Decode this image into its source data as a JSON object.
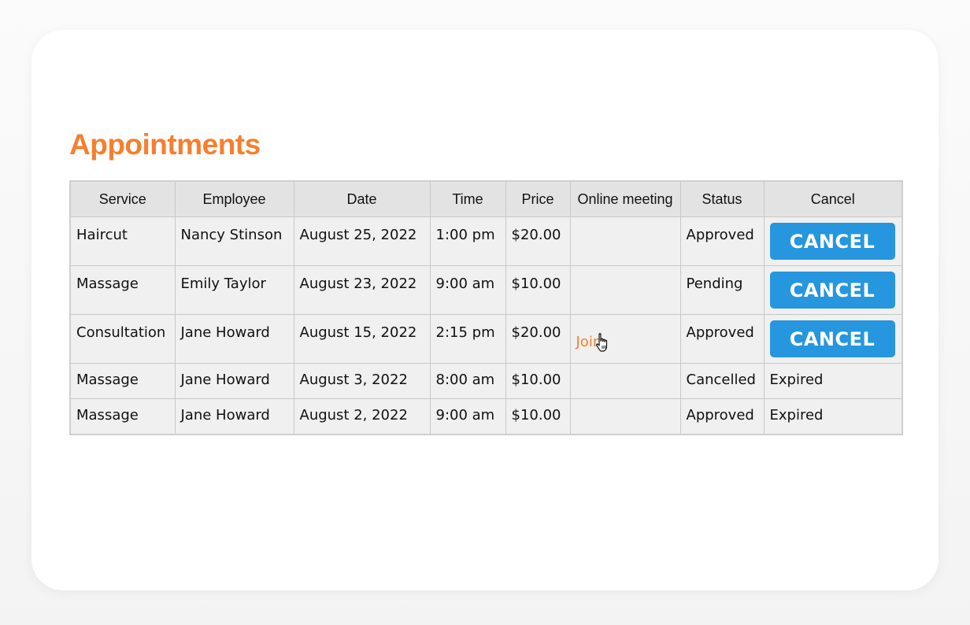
{
  "page": {
    "title": "Appointments"
  },
  "colors": {
    "title": "#f57f2f",
    "cancel_button": "#2696de",
    "join_link": "#f57f2f"
  },
  "table": {
    "headers": [
      "Service",
      "Employee",
      "Date",
      "Time",
      "Price",
      "Online meeting",
      "Status",
      "Cancel"
    ],
    "rows": [
      {
        "service": "Haircut",
        "employee": "Nancy Stinson",
        "date": "August 25, 2022",
        "time": "1:00 pm",
        "price": "$20.00",
        "meeting": "",
        "status": "Approved",
        "cancel": "CANCEL"
      },
      {
        "service": "Massage",
        "employee": "Emily Taylor",
        "date": "August 23, 2022",
        "time": "9:00 am",
        "price": "$10.00",
        "meeting": "",
        "status": "Pending",
        "cancel": "CANCEL"
      },
      {
        "service": "Consultation",
        "employee": "Jane Howard",
        "date": "August 15, 2022",
        "time": "2:15 pm",
        "price": "$20.00",
        "meeting": "Join",
        "status": "Approved",
        "cancel": "CANCEL"
      },
      {
        "service": "Massage",
        "employee": "Jane Howard",
        "date": "August 3, 2022",
        "time": "8:00 am",
        "price": "$10.00",
        "meeting": "",
        "status": "Cancelled",
        "cancel": "Expired"
      },
      {
        "service": "Massage",
        "employee": "Jane Howard",
        "date": "August 2, 2022",
        "time": "9:00 am",
        "price": "$10.00",
        "meeting": "",
        "status": "Approved",
        "cancel": "Expired"
      }
    ]
  },
  "icons": {
    "cursor": "hand-pointer-icon"
  }
}
